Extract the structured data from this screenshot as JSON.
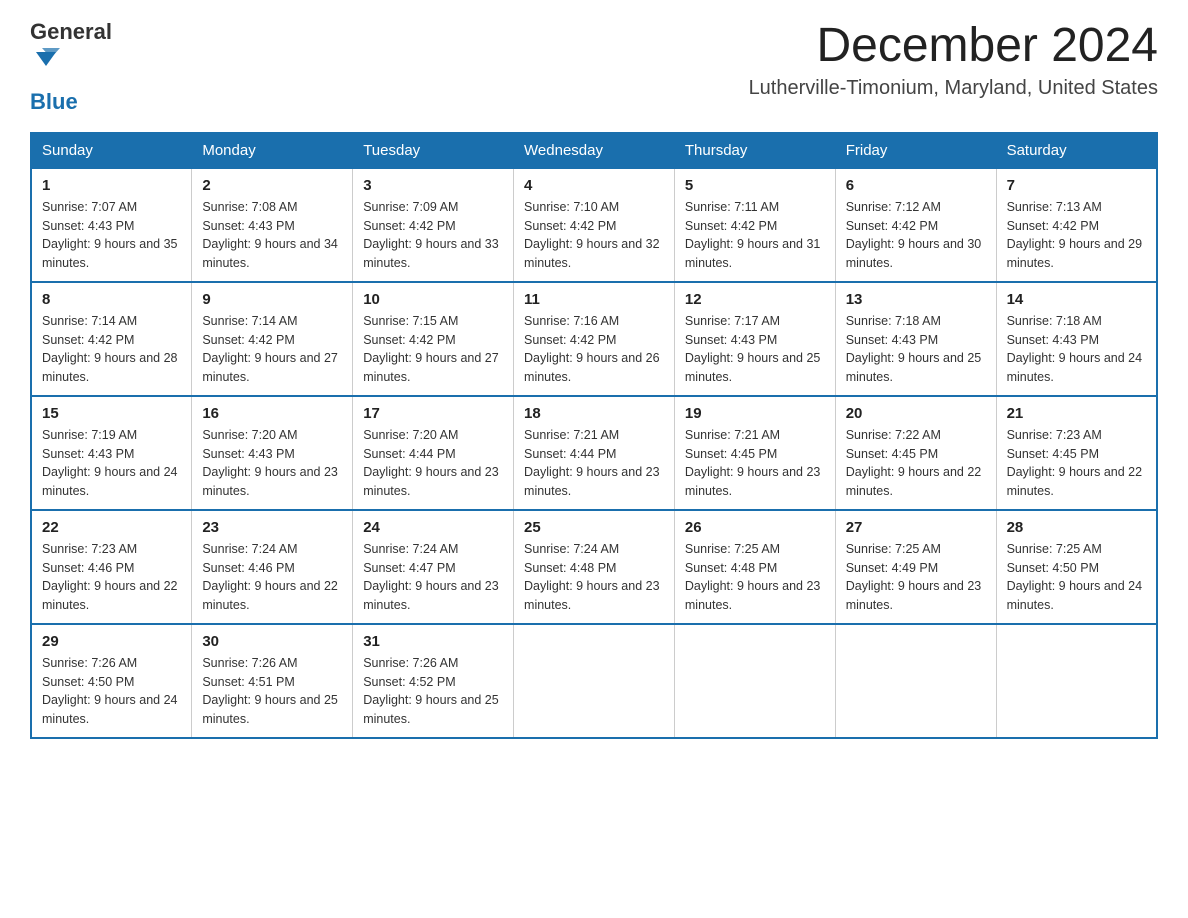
{
  "header": {
    "logo_general": "General",
    "logo_blue": "Blue",
    "month_title": "December 2024",
    "location": "Lutherville-Timonium, Maryland, United States"
  },
  "weekdays": [
    "Sunday",
    "Monday",
    "Tuesday",
    "Wednesday",
    "Thursday",
    "Friday",
    "Saturday"
  ],
  "weeks": [
    [
      {
        "day": "1",
        "sunrise": "7:07 AM",
        "sunset": "4:43 PM",
        "daylight": "9 hours and 35 minutes."
      },
      {
        "day": "2",
        "sunrise": "7:08 AM",
        "sunset": "4:43 PM",
        "daylight": "9 hours and 34 minutes."
      },
      {
        "day": "3",
        "sunrise": "7:09 AM",
        "sunset": "4:42 PM",
        "daylight": "9 hours and 33 minutes."
      },
      {
        "day": "4",
        "sunrise": "7:10 AM",
        "sunset": "4:42 PM",
        "daylight": "9 hours and 32 minutes."
      },
      {
        "day": "5",
        "sunrise": "7:11 AM",
        "sunset": "4:42 PM",
        "daylight": "9 hours and 31 minutes."
      },
      {
        "day": "6",
        "sunrise": "7:12 AM",
        "sunset": "4:42 PM",
        "daylight": "9 hours and 30 minutes."
      },
      {
        "day": "7",
        "sunrise": "7:13 AM",
        "sunset": "4:42 PM",
        "daylight": "9 hours and 29 minutes."
      }
    ],
    [
      {
        "day": "8",
        "sunrise": "7:14 AM",
        "sunset": "4:42 PM",
        "daylight": "9 hours and 28 minutes."
      },
      {
        "day": "9",
        "sunrise": "7:14 AM",
        "sunset": "4:42 PM",
        "daylight": "9 hours and 27 minutes."
      },
      {
        "day": "10",
        "sunrise": "7:15 AM",
        "sunset": "4:42 PM",
        "daylight": "9 hours and 27 minutes."
      },
      {
        "day": "11",
        "sunrise": "7:16 AM",
        "sunset": "4:42 PM",
        "daylight": "9 hours and 26 minutes."
      },
      {
        "day": "12",
        "sunrise": "7:17 AM",
        "sunset": "4:43 PM",
        "daylight": "9 hours and 25 minutes."
      },
      {
        "day": "13",
        "sunrise": "7:18 AM",
        "sunset": "4:43 PM",
        "daylight": "9 hours and 25 minutes."
      },
      {
        "day": "14",
        "sunrise": "7:18 AM",
        "sunset": "4:43 PM",
        "daylight": "9 hours and 24 minutes."
      }
    ],
    [
      {
        "day": "15",
        "sunrise": "7:19 AM",
        "sunset": "4:43 PM",
        "daylight": "9 hours and 24 minutes."
      },
      {
        "day": "16",
        "sunrise": "7:20 AM",
        "sunset": "4:43 PM",
        "daylight": "9 hours and 23 minutes."
      },
      {
        "day": "17",
        "sunrise": "7:20 AM",
        "sunset": "4:44 PM",
        "daylight": "9 hours and 23 minutes."
      },
      {
        "day": "18",
        "sunrise": "7:21 AM",
        "sunset": "4:44 PM",
        "daylight": "9 hours and 23 minutes."
      },
      {
        "day": "19",
        "sunrise": "7:21 AM",
        "sunset": "4:45 PM",
        "daylight": "9 hours and 23 minutes."
      },
      {
        "day": "20",
        "sunrise": "7:22 AM",
        "sunset": "4:45 PM",
        "daylight": "9 hours and 22 minutes."
      },
      {
        "day": "21",
        "sunrise": "7:23 AM",
        "sunset": "4:45 PM",
        "daylight": "9 hours and 22 minutes."
      }
    ],
    [
      {
        "day": "22",
        "sunrise": "7:23 AM",
        "sunset": "4:46 PM",
        "daylight": "9 hours and 22 minutes."
      },
      {
        "day": "23",
        "sunrise": "7:24 AM",
        "sunset": "4:46 PM",
        "daylight": "9 hours and 22 minutes."
      },
      {
        "day": "24",
        "sunrise": "7:24 AM",
        "sunset": "4:47 PM",
        "daylight": "9 hours and 23 minutes."
      },
      {
        "day": "25",
        "sunrise": "7:24 AM",
        "sunset": "4:48 PM",
        "daylight": "9 hours and 23 minutes."
      },
      {
        "day": "26",
        "sunrise": "7:25 AM",
        "sunset": "4:48 PM",
        "daylight": "9 hours and 23 minutes."
      },
      {
        "day": "27",
        "sunrise": "7:25 AM",
        "sunset": "4:49 PM",
        "daylight": "9 hours and 23 minutes."
      },
      {
        "day": "28",
        "sunrise": "7:25 AM",
        "sunset": "4:50 PM",
        "daylight": "9 hours and 24 minutes."
      }
    ],
    [
      {
        "day": "29",
        "sunrise": "7:26 AM",
        "sunset": "4:50 PM",
        "daylight": "9 hours and 24 minutes."
      },
      {
        "day": "30",
        "sunrise": "7:26 AM",
        "sunset": "4:51 PM",
        "daylight": "9 hours and 25 minutes."
      },
      {
        "day": "31",
        "sunrise": "7:26 AM",
        "sunset": "4:52 PM",
        "daylight": "9 hours and 25 minutes."
      },
      null,
      null,
      null,
      null
    ]
  ]
}
